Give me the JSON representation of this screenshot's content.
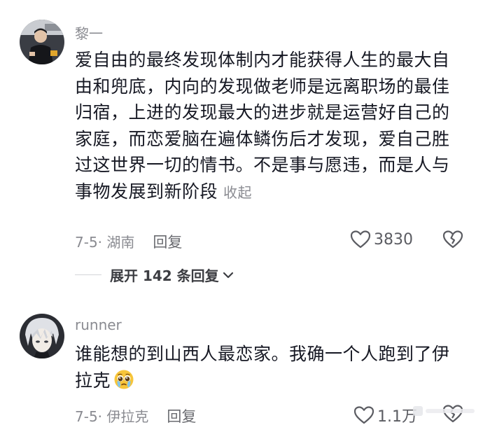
{
  "comments": [
    {
      "username": "黎一",
      "text_lines": [
        "爱自由的最终发现体制内才能获得人生的最大自",
        "由和兜底，内向的发现做老师是远离职场的最佳",
        "归宿，上进的发现最大的进步就是运营好自己的",
        "家庭，而恋爱脑在遍体鳞伤后才发现，爱自己胜",
        "过这世界一切的情书。不是事与愿违，而是人与",
        "事物发展到新阶段"
      ],
      "collapse_label": "收起",
      "date_location": "7-5· 湖南",
      "reply_label": "回复",
      "like_count": "3830",
      "expand_label": "展开 142 条回复",
      "avatar_icon": "person-photo-avatar",
      "like_icon": "heart-outline-icon",
      "dislike_icon": "broken-heart-icon"
    },
    {
      "username": "runner",
      "text_lines": [
        "谁能想的到山西人最恋家。我确一个人跑到了伊",
        "拉克"
      ],
      "emoji_icon": "pleading-face-emoji",
      "date_location": "7-5· 伊拉克",
      "reply_label": "回复",
      "like_count": "1.1万",
      "avatar_icon": "anime-character-avatar",
      "like_icon": "heart-outline-icon",
      "dislike_icon": "broken-heart-icon"
    }
  ],
  "colors": {
    "text_primary": "#161823",
    "text_secondary": "#8a8b91",
    "divider": "#d3d4d8",
    "background": "#ffffff"
  }
}
